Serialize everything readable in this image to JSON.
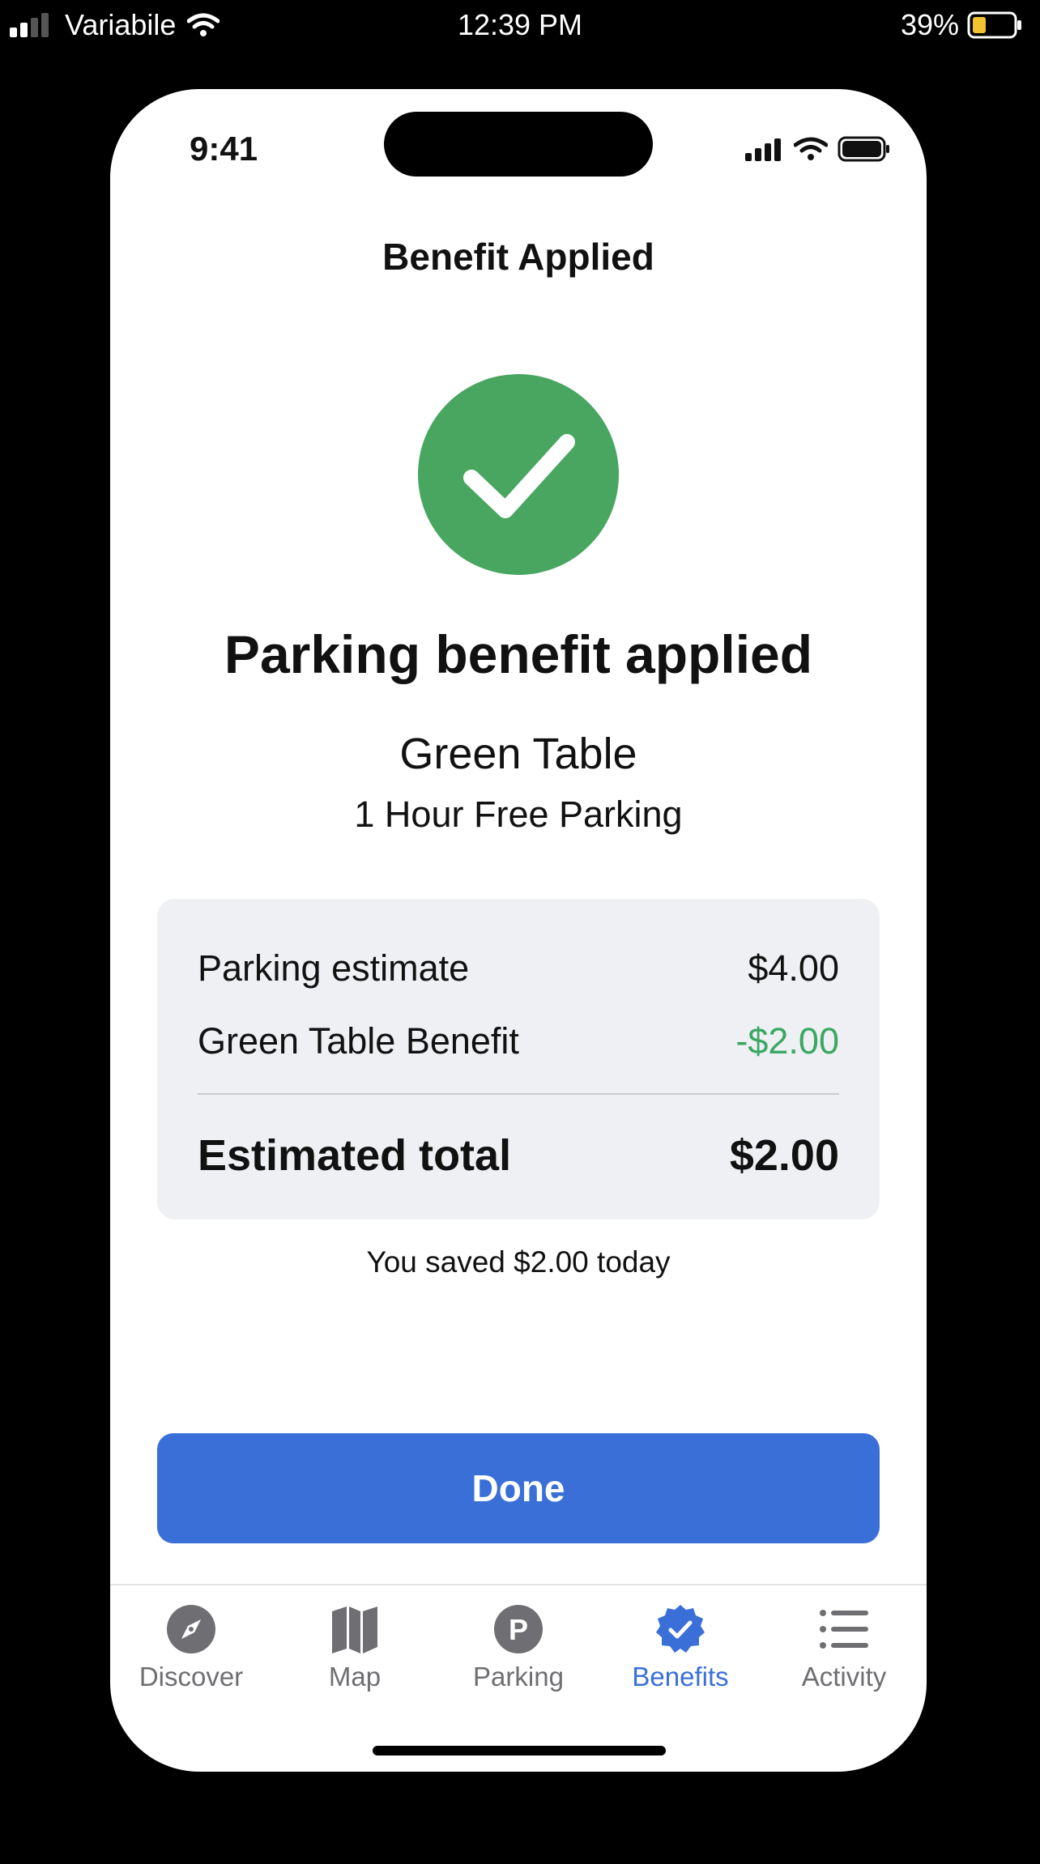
{
  "outer_status": {
    "carrier": "Variabile",
    "time": "12:39 PM",
    "battery": "39%"
  },
  "device_status": {
    "time": "9:41"
  },
  "screen": {
    "title": "Benefit Applied",
    "headline": "Parking benefit applied",
    "merchant": "Green Table",
    "offer": "1 Hour Free Parking",
    "icon": "check-circle-icon",
    "success_color": "#48a660"
  },
  "summary": {
    "rows": [
      {
        "label": "Parking estimate",
        "value": "$4.00"
      },
      {
        "label": "Green Table Benefit",
        "value": "-$2.00",
        "color": "#3aa863"
      }
    ],
    "total": {
      "label": "Estimated total",
      "value": "$2.00"
    }
  },
  "saved_note": "You saved $2.00 today",
  "done_button": {
    "label": "Done",
    "color": "#3a6fd8"
  },
  "tabs": [
    {
      "label": "Discover",
      "icon": "compass-icon",
      "active": false
    },
    {
      "label": "Map",
      "icon": "map-icon",
      "active": false
    },
    {
      "label": "Parking",
      "icon": "parking-icon",
      "active": false
    },
    {
      "label": "Benefits",
      "icon": "verified-badge-icon",
      "active": true
    },
    {
      "label": "Activity",
      "icon": "list-icon",
      "active": false
    }
  ]
}
